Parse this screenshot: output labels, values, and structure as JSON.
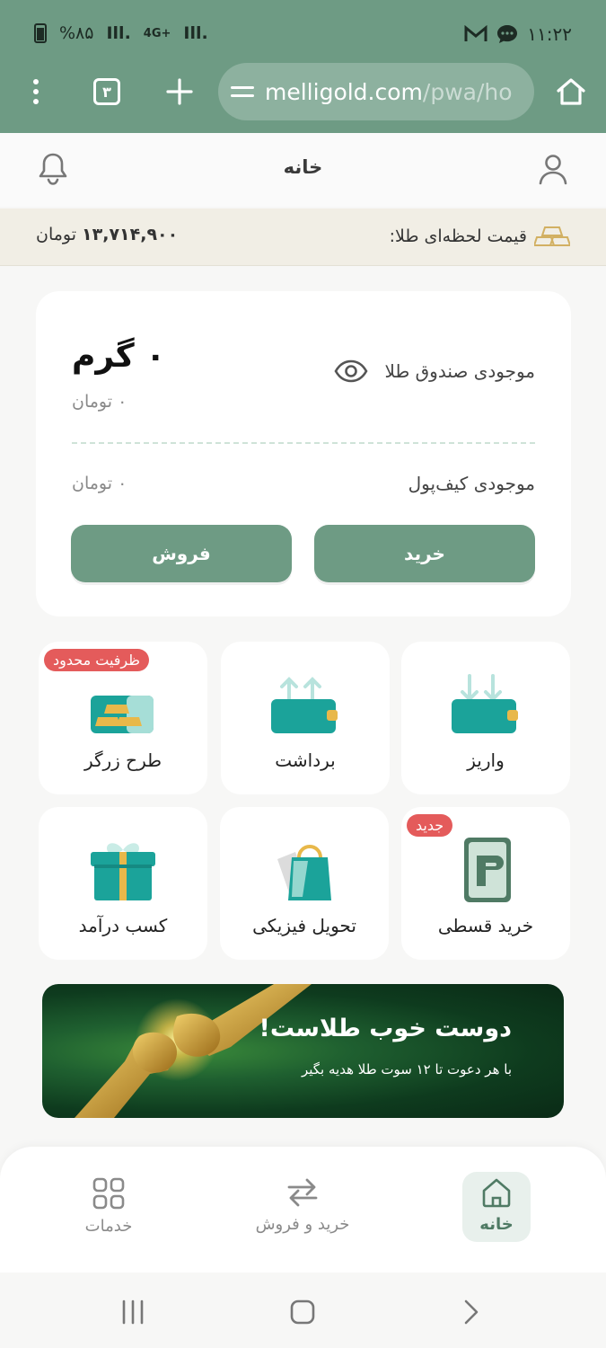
{
  "status_bar": {
    "battery": "%۸۵",
    "signal1": "Ill.",
    "network": "4G+",
    "signal2": "Ill.",
    "time": "۱۱:۲۲",
    "notif_icons": [
      "gmail-icon",
      "chat-bubble-icon"
    ]
  },
  "browser": {
    "tab_count": "۳",
    "url_domain": "melligold.com",
    "url_path": "/pwa/ho"
  },
  "header": {
    "title": "خانه"
  },
  "gold_price": {
    "label": "قیمت لحظه‌ای طلا:",
    "value": "۱۳,۷۱۴,۹۰۰",
    "unit": "تومان"
  },
  "balance": {
    "grams": "۰ گرم",
    "grams_toman": "۰ تومان",
    "fund_label": "موجودی صندوق طلا",
    "wallet_label": "موجودی کیف‌پول",
    "wallet_toman": "۰ تومان",
    "buy_label": "خرید",
    "sell_label": "فروش"
  },
  "tiles": [
    {
      "label": "واریز",
      "icon": "wallet-deposit-icon"
    },
    {
      "label": "برداشت",
      "icon": "wallet-withdraw-icon"
    },
    {
      "label": "طرح زرگر",
      "icon": "gold-bars-icon",
      "badge": "ظرفیت محدود"
    },
    {
      "label": "خرید قسطی",
      "icon": "installment-card-icon",
      "badge": "جدید"
    },
    {
      "label": "تحویل فیزیکی",
      "icon": "shopping-bag-icon"
    },
    {
      "label": "کسب درآمد",
      "icon": "gift-box-icon"
    }
  ],
  "banner": {
    "headline": "دوست خوب طلاست!",
    "subline": "با هر دعوت تا ۱۲ سوت طلا هدیه بگیر"
  },
  "bottom_nav": {
    "home": "خانه",
    "trade": "خرید و فروش",
    "services": "خدمات"
  },
  "colors": {
    "brand_green": "#6e9b84",
    "badge_red": "#e45b5b",
    "teal": "#1ba39a",
    "gold": "#e8b84a"
  }
}
